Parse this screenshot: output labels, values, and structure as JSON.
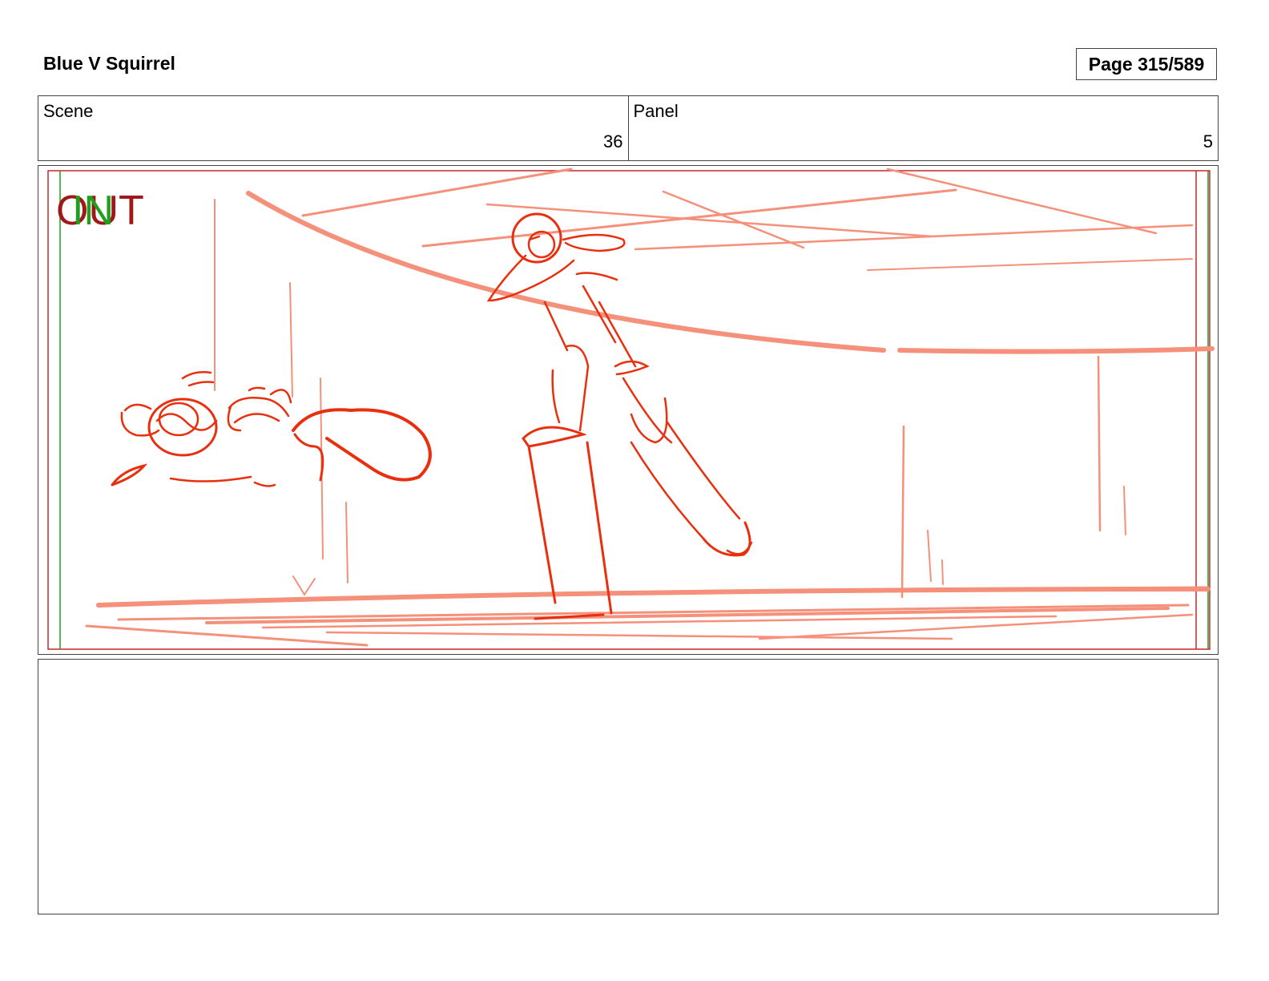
{
  "header": {
    "project_title": "Blue V Squirrel",
    "page_label": "Page 315/589"
  },
  "scene": {
    "label": "Scene",
    "value": "36"
  },
  "panel": {
    "label": "Panel",
    "value": "5"
  },
  "frame_markers": {
    "in_label": "IN",
    "out_label": "OUT"
  },
  "colors": {
    "sketch_dark": "#e8300f",
    "sketch_light": "#f5907a",
    "out_marker": "#a01818",
    "in_marker": "#1ea01e"
  },
  "notes": {
    "text": ""
  }
}
